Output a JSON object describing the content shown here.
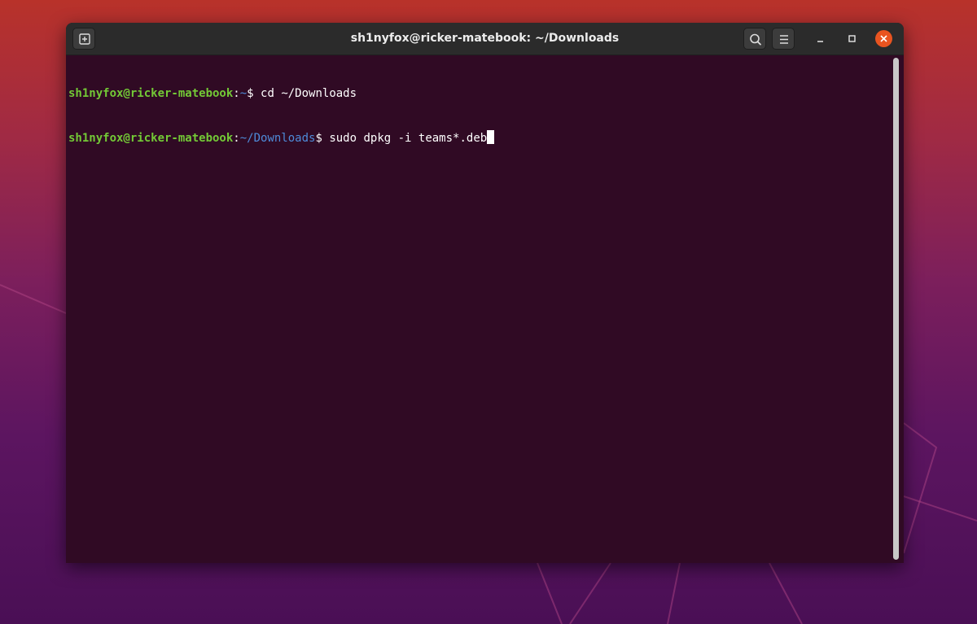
{
  "window": {
    "title": "sh1nyfox@ricker-matebook: ~/Downloads"
  },
  "toolbar": {
    "new_tab_icon": "new-tab-icon",
    "search_icon": "search-icon",
    "menu_icon": "hamburger-menu-icon",
    "minimize_icon": "minimize-icon",
    "maximize_icon": "maximize-icon",
    "close_icon": "close-icon"
  },
  "terminal": {
    "lines": [
      {
        "user_host": "sh1nyfox@ricker-matebook",
        "separator": ":",
        "path": "~",
        "prompt": "$ ",
        "command": "cd ~/Downloads"
      },
      {
        "user_host": "sh1nyfox@ricker-matebook",
        "separator": ":",
        "path": "~/Downloads",
        "prompt": "$ ",
        "command": "sudo dpkg -i teams*.deb"
      }
    ]
  },
  "colors": {
    "terminal_bg": "#300a24",
    "user_host": "#73c936",
    "path": "#4e8bd9",
    "close_button": "#e95420",
    "titlebar": "#2b2b2b"
  }
}
